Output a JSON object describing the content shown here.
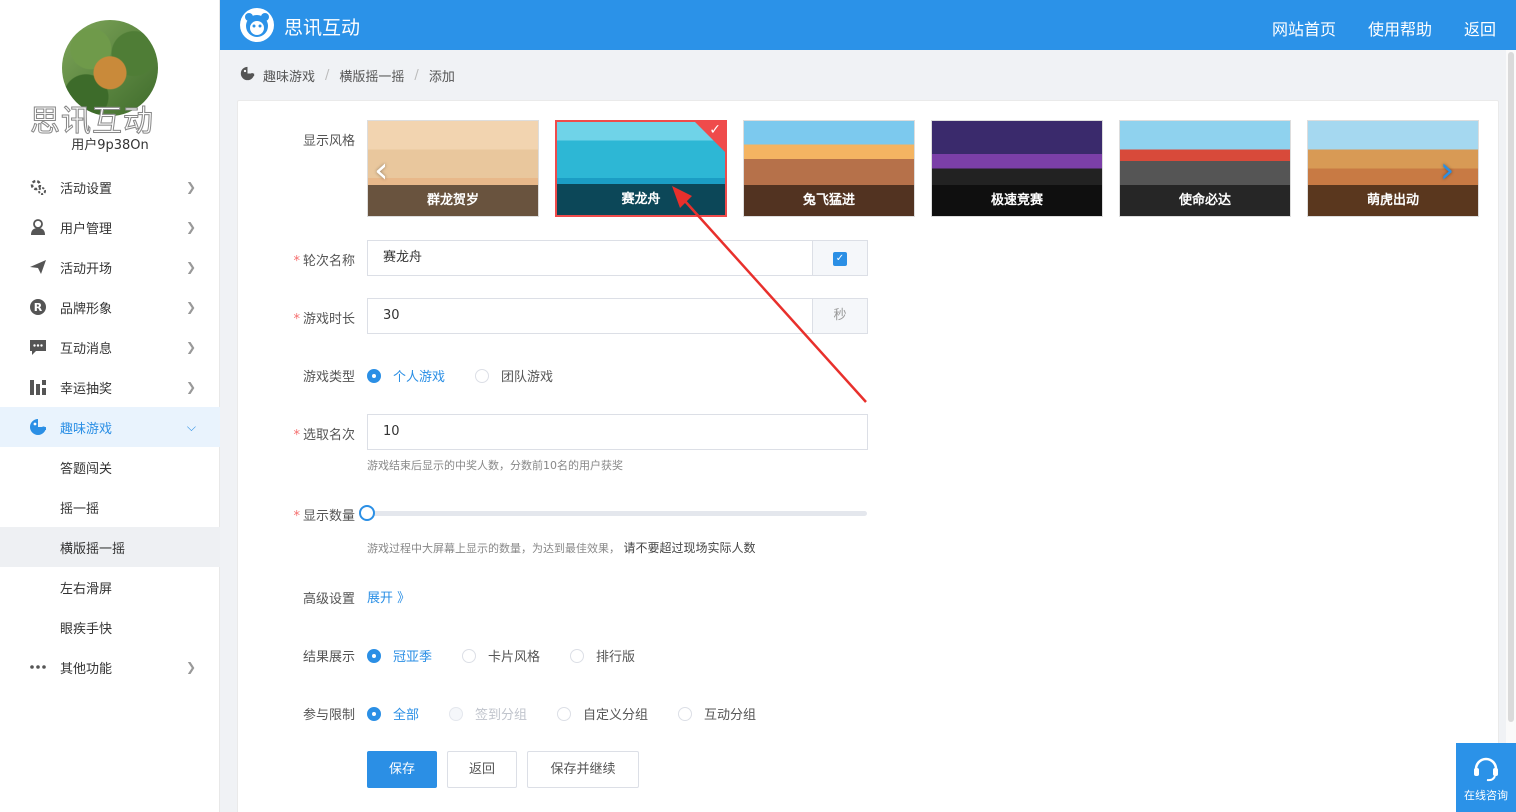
{
  "sidebar": {
    "brand_overlay": "思讯互动",
    "username": "用户9p38On",
    "menu": [
      {
        "label": "活动设置",
        "icon": "gear-icon"
      },
      {
        "label": "用户管理",
        "icon": "user-icon"
      },
      {
        "label": "活动开场",
        "icon": "paper-plane-icon"
      },
      {
        "label": "品牌形象",
        "icon": "registered-icon"
      },
      {
        "label": "互动消息",
        "icon": "chat-icon"
      },
      {
        "label": "幸运抽奖",
        "icon": "lottery-icon"
      },
      {
        "label": "趣味游戏",
        "icon": "game-icon",
        "active": true
      },
      {
        "label": "其他功能",
        "icon": "more-icon"
      }
    ],
    "submenu": [
      "答题闯关",
      "摇一摇",
      "横版摇一摇",
      "左右滑屏",
      "眼疾手快"
    ]
  },
  "header": {
    "title": "思讯互动",
    "links": [
      "网站首页",
      "使用帮助",
      "返回"
    ],
    "accent": "#2b92e8"
  },
  "breadcrumb": [
    "趣味游戏",
    "横版摇一摇",
    "添加"
  ],
  "form": {
    "style_label": "显示风格",
    "styles": [
      "群龙贺岁",
      "赛龙舟",
      "兔飞猛进",
      "极速竞赛",
      "使命必达",
      "萌虎出动"
    ],
    "selected_style": "赛龙舟",
    "round_label": "轮次名称",
    "round_value": "赛龙舟",
    "duration_label": "游戏时长",
    "duration_value": "30",
    "duration_unit": "秒",
    "type_label": "游戏类型",
    "type_options": [
      "个人游戏",
      "团队游戏"
    ],
    "rank_label": "选取名次",
    "rank_value": "10",
    "rank_hint": "游戏结束后显示的中奖人数，分数前10名的用户获奖",
    "count_label": "显示数量",
    "count_hint": "游戏过程中大屏幕上显示的数量，为达到最佳效果，",
    "count_hint_strong": "请不要超过现场实际人数",
    "advanced_label": "高级设置",
    "advanced_link": "展开 》",
    "result_label": "结果展示",
    "result_options": [
      "冠亚季",
      "卡片风格",
      "排行版"
    ],
    "limit_label": "参与限制",
    "limit_options": [
      "全部",
      "签到分组",
      "自定义分组",
      "互动分组"
    ],
    "buttons": [
      "保存",
      "返回",
      "保存并继续"
    ]
  },
  "consult": "在线咨询"
}
